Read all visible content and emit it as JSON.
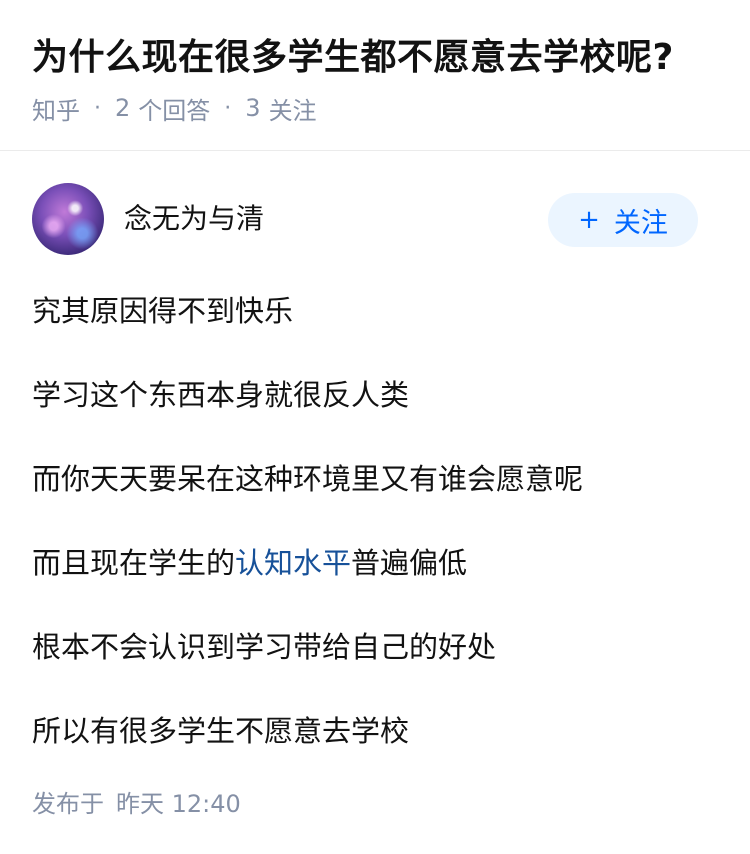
{
  "question": {
    "title": "为什么现在很多学生都不愿意去学校呢?",
    "source": "知乎",
    "answer_count": "2",
    "answer_label": "个回答",
    "follower_count": "3",
    "follower_label": "关注"
  },
  "answer": {
    "author": {
      "name": "念无为与清",
      "follow_plus": "+",
      "follow_label": "关注"
    },
    "paragraphs": {
      "p1": "究其原因得不到快乐",
      "p2": "学习这个东西本身就很反人类",
      "p3": "而你天天要呆在这种环境里又有谁会愿意呢",
      "p4_before": "而且现在学生的",
      "p4_link": "认知水平",
      "p4_after": "普遍偏低",
      "p5": "根本不会认识到学习带给自己的好处",
      "p6": "所以有很多学生不愿意去学校"
    },
    "publish_label": "发布于",
    "publish_time": "昨天 12:40"
  },
  "colors": {
    "link": "#175199",
    "follow_text": "#0066ff",
    "follow_bg": "#ebf5ff",
    "meta": "#8590a6"
  }
}
